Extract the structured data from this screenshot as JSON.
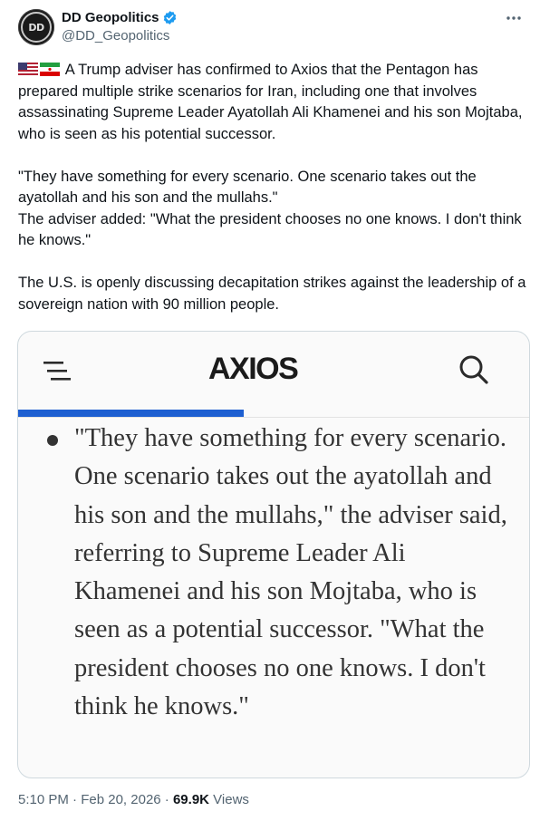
{
  "author": {
    "name": "DD Geopolitics",
    "handle": "@DD_Geopolitics",
    "avatar_text": "DD"
  },
  "post": {
    "flags": [
      "us-flag",
      "iran-flag"
    ],
    "para1": "A Trump adviser has confirmed to Axios that the Pentagon has prepared multiple strike scenarios for Iran, including one that involves assassinating Supreme Leader Ayatollah Ali Khamenei and his son Mojtaba, who is seen as his potential successor.",
    "para2_line1": "\"They have something for every scenario. One scenario takes out the ayatollah and his son and the mullahs.\"",
    "para2_line2": "The adviser added: \"What the president chooses no one knows. I don't think he knows.\"",
    "para3": "The U.S. is openly discussing decapitation strikes against the leadership of a sovereign nation with 90 million people."
  },
  "card": {
    "logo": "AXIOS",
    "quote": "\"They have something for every scenario. One scenario takes out the ayatollah and his son and the mullahs,\" the adviser said, referring to Supreme Leader Ali Khamenei and his son Mojtaba, who is seen as a potential successor. \"What the president chooses no one knows. I don't think he knows.\"",
    "accent_color": "#1e5fd1"
  },
  "meta": {
    "time": "5:10 PM",
    "date": "Feb 20, 2026",
    "views_count": "69.9K",
    "views_label": "Views"
  },
  "colors": {
    "verified": "#1d9bf0",
    "secondary_text": "#536471"
  }
}
